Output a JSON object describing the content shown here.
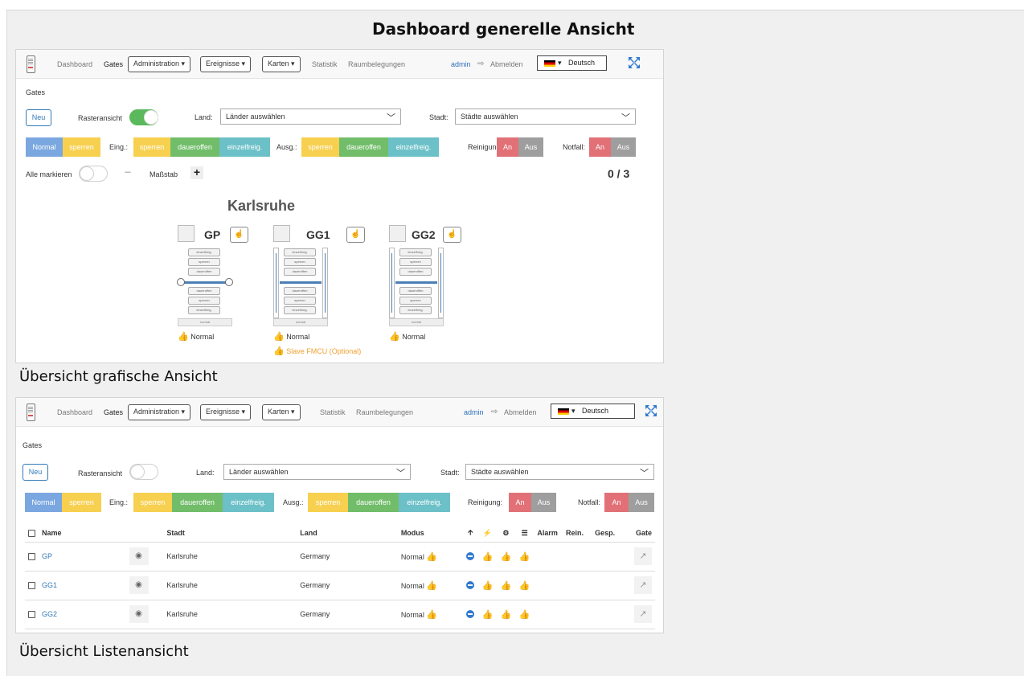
{
  "title": "Dashboard generelle Ansicht",
  "captions": {
    "grafisch": "Übersicht grafische Ansicht",
    "liste": "Übersicht Listenansicht"
  },
  "navbar": {
    "dashboard": "Dashboard",
    "gates": "Gates",
    "administration": "Administration ▾",
    "ereignisse": "Ereignisse ▾",
    "karten": "Karten ▾",
    "statistik": "Statistik",
    "raumbelegungen": "Raumbelegungen",
    "user": "admin",
    "logout": "Abmelden",
    "language": "Deutsch",
    "language_caret": "▾"
  },
  "page_heading": "Gates",
  "controls": {
    "neu": "Neu",
    "rasteransicht": "Rasteransicht",
    "land_label": "Land:",
    "land_placeholder": "Länder auswählen",
    "stadt_label": "Stadt:",
    "stadt_placeholder": "Städte auswählen",
    "chevron": "﹀"
  },
  "mode_bar": {
    "normal": "Normal",
    "sperren": "sperren",
    "eing_label": "Eing.:",
    "daueroffen": "daueroffen",
    "einzelfreig": "einzelfreig.",
    "ausg_label": "Ausg.:",
    "reinigung_label": "Reinigung:",
    "notfall_label": "Notfall:",
    "an": "An",
    "aus": "Aus"
  },
  "grid_view": {
    "alle_markieren": "Alle markieren",
    "minus": "−",
    "massstab": "Maßstab",
    "plus": "+",
    "counter": "0 / 3",
    "city": "Karlsruhe",
    "diagram_labels": [
      "einzelfreig.",
      "sperren",
      "daueroffen",
      "daueroffen",
      "sperren",
      "einzelfreig."
    ],
    "diagram_footer": "normal",
    "gates": [
      {
        "name": "GP",
        "status": "Normal"
      },
      {
        "name": "GG1",
        "status": "Normal",
        "warning": "Slave FMCU (Optional)"
      },
      {
        "name": "GG2",
        "status": "Normal"
      }
    ]
  },
  "list_view": {
    "columns": [
      "Name",
      "Stadt",
      "Land",
      "Modus",
      "Alarm",
      "Rein.",
      "Gesp.",
      "Gate"
    ],
    "rows": [
      {
        "name": "GP",
        "stadt": "Karlsruhe",
        "land": "Germany",
        "modus": "Normal"
      },
      {
        "name": "GG1",
        "stadt": "Karlsruhe",
        "land": "Germany",
        "modus": "Normal"
      },
      {
        "name": "GG2",
        "stadt": "Karlsruhe",
        "land": "Germany",
        "modus": "Normal"
      }
    ]
  },
  "colors": {
    "blue": "#7ba7e0",
    "yellow": "#f7d050",
    "green": "#71bd6a",
    "teal": "#6cc0c8",
    "red": "#e17177",
    "grey": "#9e9e9e"
  }
}
